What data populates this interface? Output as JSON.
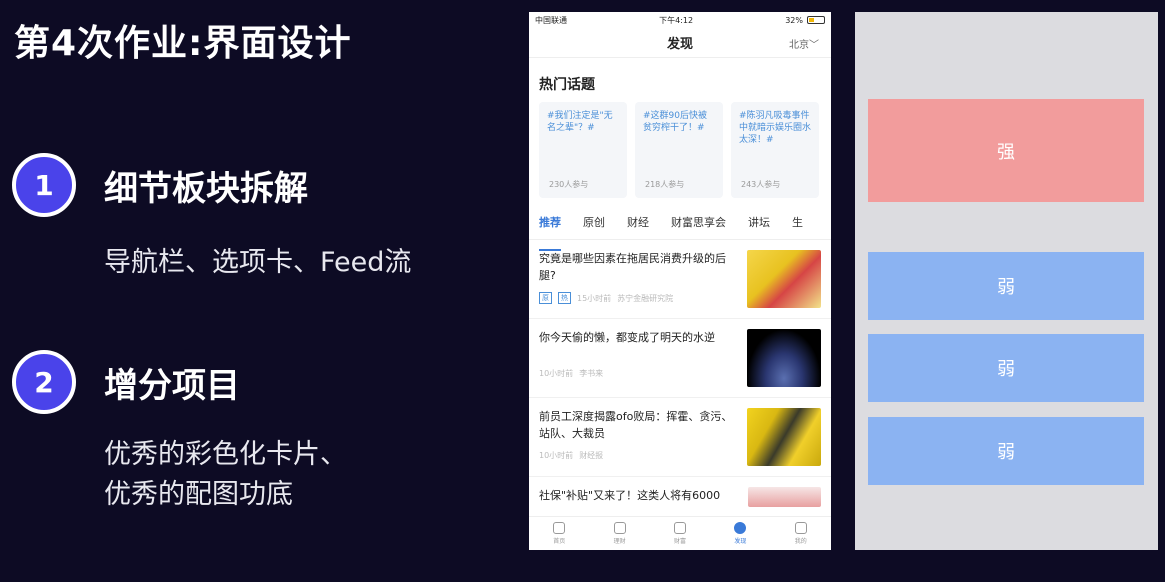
{
  "slide": {
    "title": "第4次作业:界面设计",
    "points": [
      {
        "num": "1",
        "heading": "细节板块拆解",
        "lines": [
          "导航栏、选项卡、Feed流"
        ]
      },
      {
        "num": "2",
        "heading": "增分项目",
        "lines": [
          "优秀的彩色化卡片、",
          "优秀的配图功底"
        ]
      }
    ]
  },
  "phone": {
    "status": {
      "carrier": "中国联通",
      "time": "下午4:12",
      "battery": "32%"
    },
    "nav": {
      "title": "发现",
      "city": "北京"
    },
    "hot_title": "热门话题",
    "topics": [
      {
        "text": "#我们注定是\"无名之辈\"？#",
        "meta": "230人参与"
      },
      {
        "text": "#这群90后快被贫穷榨干了！#",
        "meta": "218人参与"
      },
      {
        "text": "#陈羽凡吸毒事件中就暗示娱乐圈水太深！#",
        "meta": "243人参与"
      }
    ],
    "tabs": [
      "推荐",
      "原创",
      "财经",
      "财富思享会",
      "讲坛",
      "生"
    ],
    "feed": [
      {
        "title": "究竟是哪些因素在拖居民消费升级的后腿?",
        "tags": [
          "原",
          "热"
        ],
        "time": "15小时前",
        "source": "苏宁金融研究院"
      },
      {
        "title": "你今天偷的懒，都变成了明天的水逆",
        "tags": [],
        "time": "10小时前",
        "source": "李书来"
      },
      {
        "title": "前员工深度揭露ofo败局：挥霍、贪污、站队、大裁员",
        "tags": [],
        "time": "10小时前",
        "source": "财经报"
      },
      {
        "title": "社保\"补贴\"又来了！这类人将有6000",
        "tags": [],
        "time": "",
        "source": ""
      }
    ],
    "tabbar": [
      "首页",
      "理财",
      "财富",
      "发现",
      "我的"
    ]
  },
  "wire": {
    "strong": "强",
    "weak": [
      "弱",
      "弱",
      "弱"
    ]
  },
  "colors": {
    "accent": "#4a43ea",
    "strong": "#f29c9c",
    "weak": "#8bb3f2",
    "link": "#3a7ad8"
  }
}
